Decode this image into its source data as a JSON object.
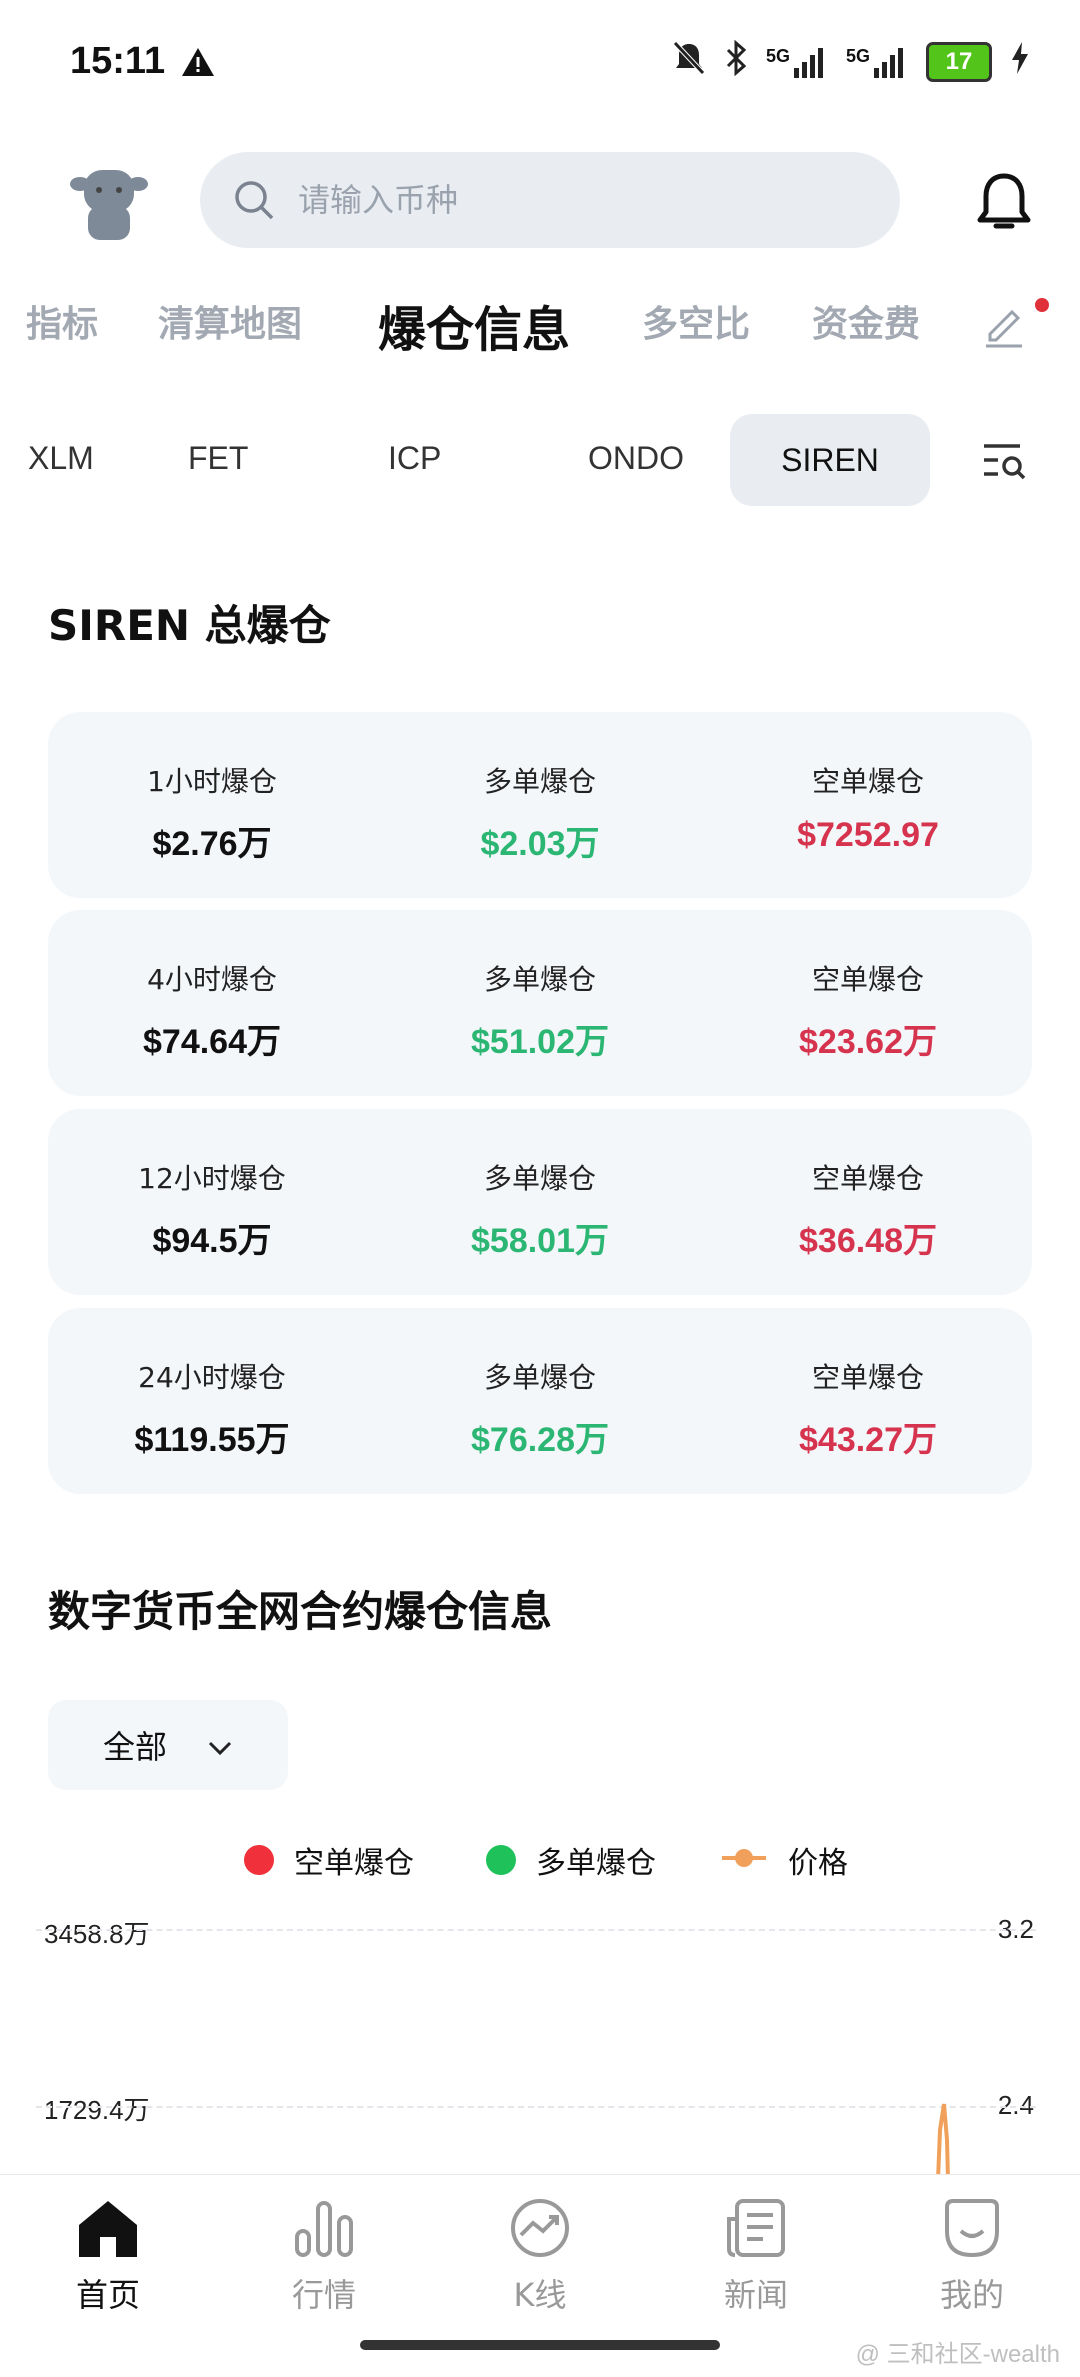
{
  "status_bar": {
    "time": "15:11",
    "network1": "5G",
    "network2": "5G",
    "battery": "17"
  },
  "search": {
    "placeholder": "请输入币种"
  },
  "category_tabs": [
    {
      "label": "指标"
    },
    {
      "label": "清算地图"
    },
    {
      "label": "爆仓信息"
    },
    {
      "label": "多空比"
    },
    {
      "label": "资金费"
    }
  ],
  "coin_tabs": [
    {
      "label": "XLM"
    },
    {
      "label": "FET"
    },
    {
      "label": "ICP"
    },
    {
      "label": "ONDO"
    },
    {
      "label": "SIREN"
    }
  ],
  "section_title": "SIREN 总爆仓",
  "stats": [
    {
      "period": "1小时爆仓",
      "total": "$2.76万",
      "long_label": "多单爆仓",
      "long": "$2.03万",
      "short_label": "空单爆仓",
      "short": "$7252.97"
    },
    {
      "period": "4小时爆仓",
      "total": "$74.64万",
      "long_label": "多单爆仓",
      "long": "$51.02万",
      "short_label": "空单爆仓",
      "short": "$23.62万"
    },
    {
      "period": "12小时爆仓",
      "total": "$94.5万",
      "long_label": "多单爆仓",
      "long": "$58.01万",
      "short_label": "空单爆仓",
      "short": "$36.48万"
    },
    {
      "period": "24小时爆仓",
      "total": "$119.55万",
      "long_label": "多单爆仓",
      "long": "$76.28万",
      "short_label": "空单爆仓",
      "short": "$43.27万"
    }
  ],
  "section2_title": "数字货币全网合约爆仓信息",
  "filter": {
    "selected": "全部"
  },
  "legend": [
    {
      "label": "空单爆仓",
      "color": "#f0303a"
    },
    {
      "label": "多单爆仓",
      "color": "#1fc25a"
    },
    {
      "label": "价格",
      "color": "#f0a05a"
    }
  ],
  "chart_data": {
    "type": "line",
    "y_left_ticks": [
      "3458.8万",
      "1729.4万"
    ],
    "y_right_ticks": [
      "3.2",
      "2.4"
    ]
  },
  "bottom_nav": [
    {
      "label": "首页",
      "icon": "home-icon"
    },
    {
      "label": "行情",
      "icon": "market-bars-icon"
    },
    {
      "label": "K线",
      "icon": "kline-chart-icon"
    },
    {
      "label": "新闻",
      "icon": "news-icon"
    },
    {
      "label": "我的",
      "icon": "profile-icon"
    }
  ],
  "watermark": "@ 三和社区-wealth",
  "colors": {
    "green": "#2bb673",
    "red": "#d5334e",
    "active_text": "#111111",
    "inactive_text": "#a3a9b2"
  }
}
